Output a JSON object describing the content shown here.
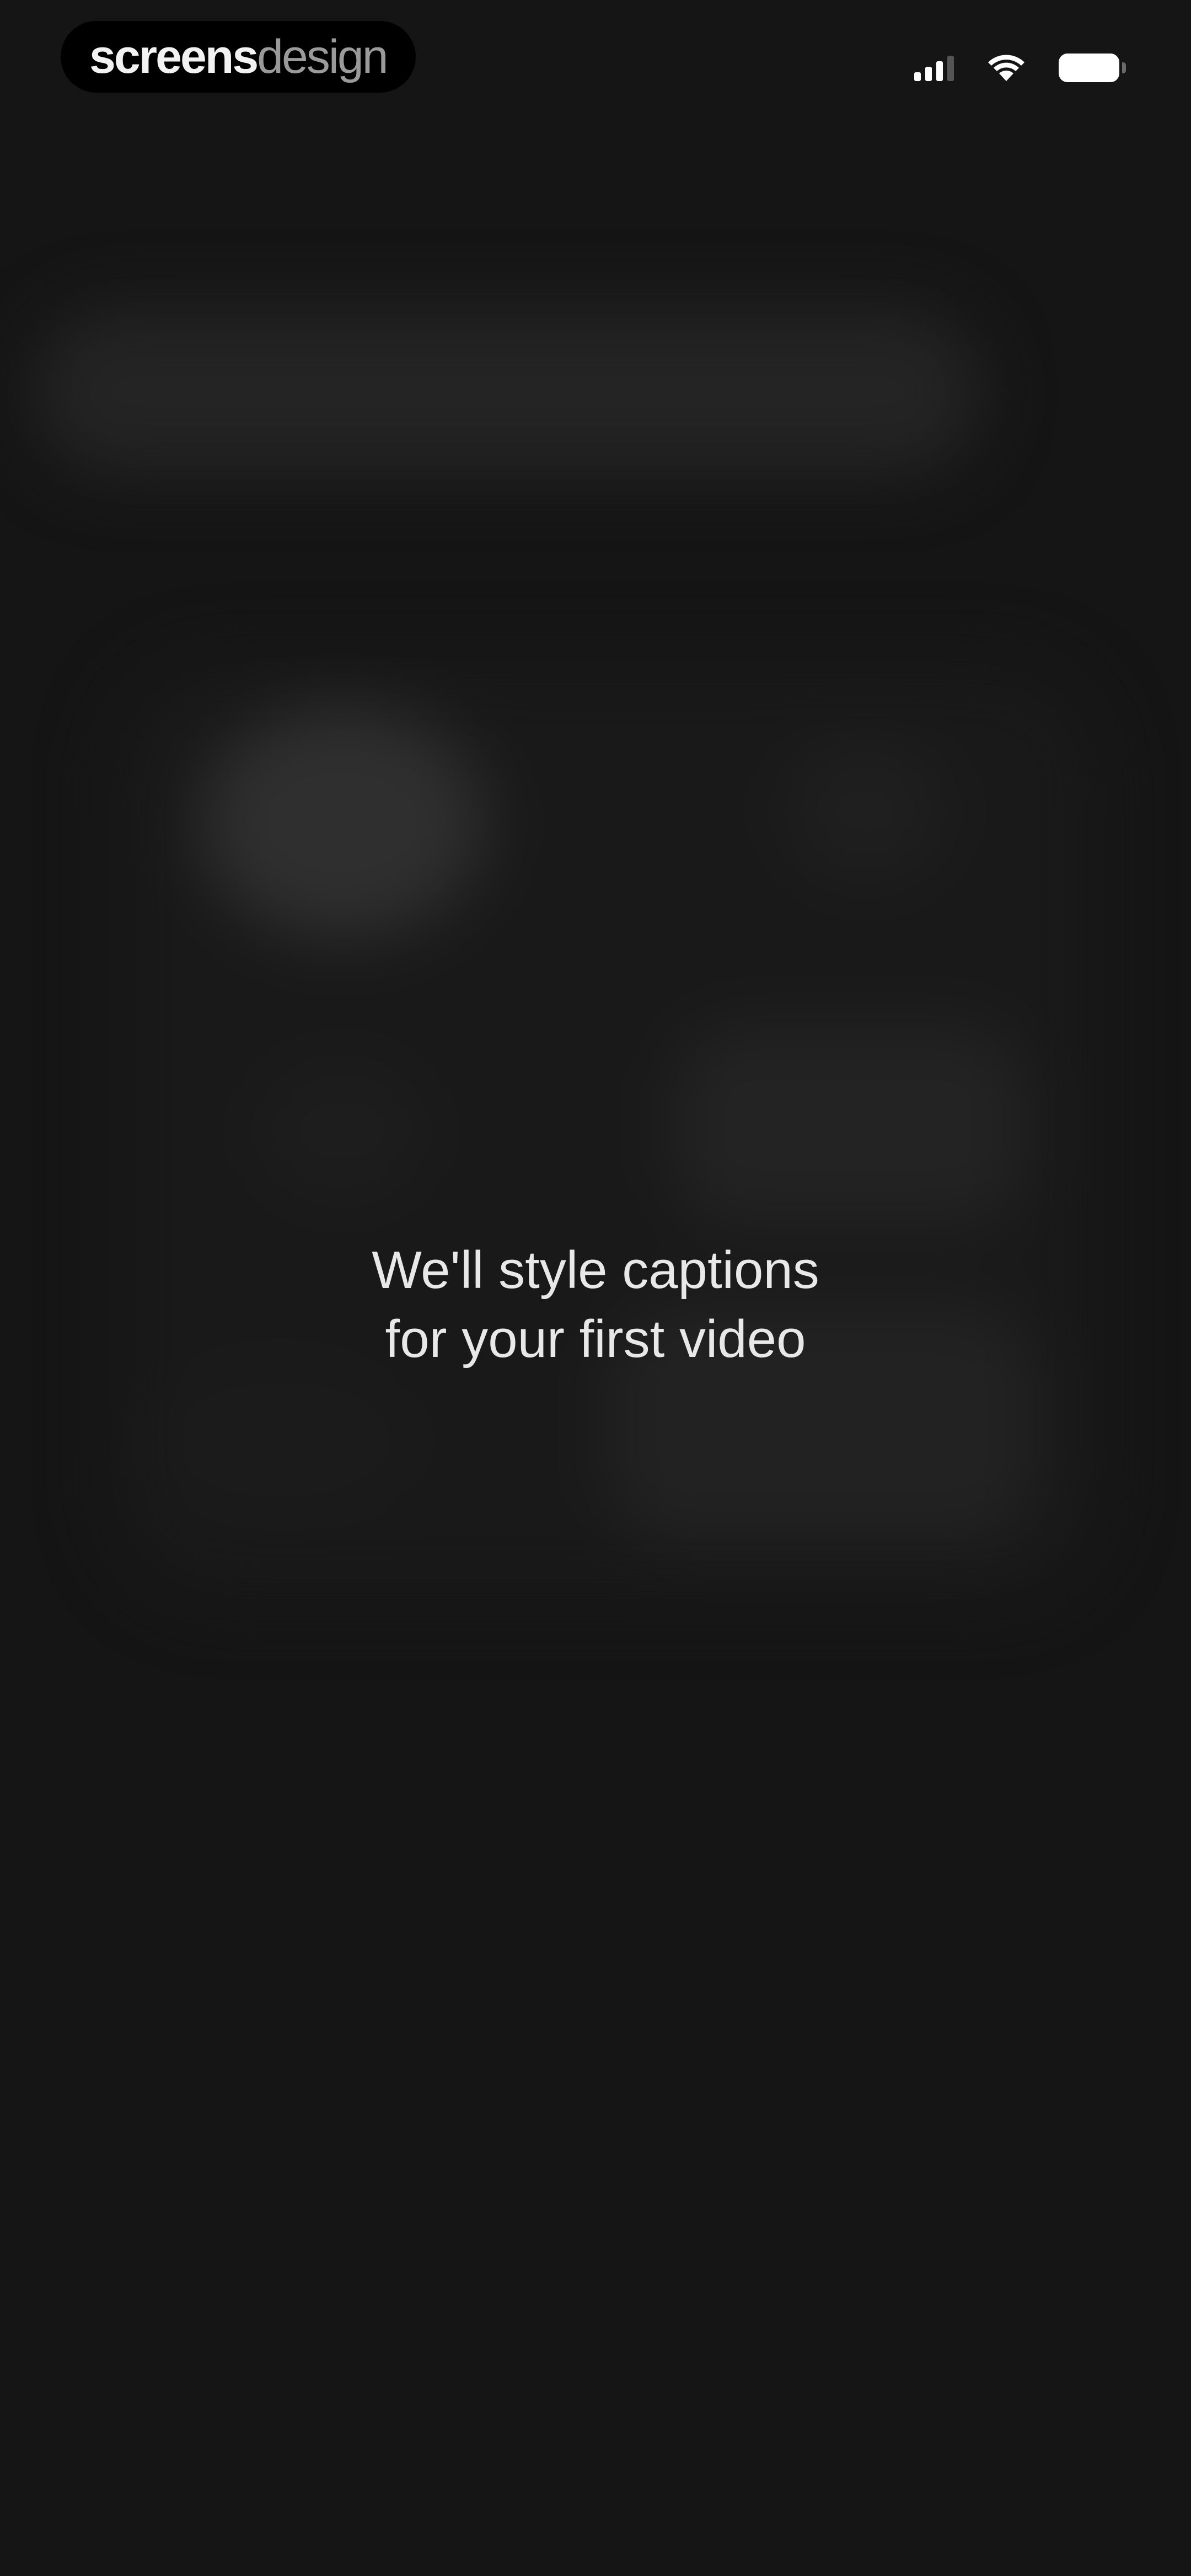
{
  "status_bar": {
    "brand_bold": "screens",
    "brand_light": "design",
    "signal_icon": "cellular-signal-icon",
    "wifi_icon": "wifi-icon",
    "battery_icon": "battery-icon"
  },
  "main": {
    "headline_line1": "We'll style captions",
    "headline_line2": "for your first video"
  },
  "colors": {
    "background": "#151515",
    "text": "#e8e8e8"
  }
}
